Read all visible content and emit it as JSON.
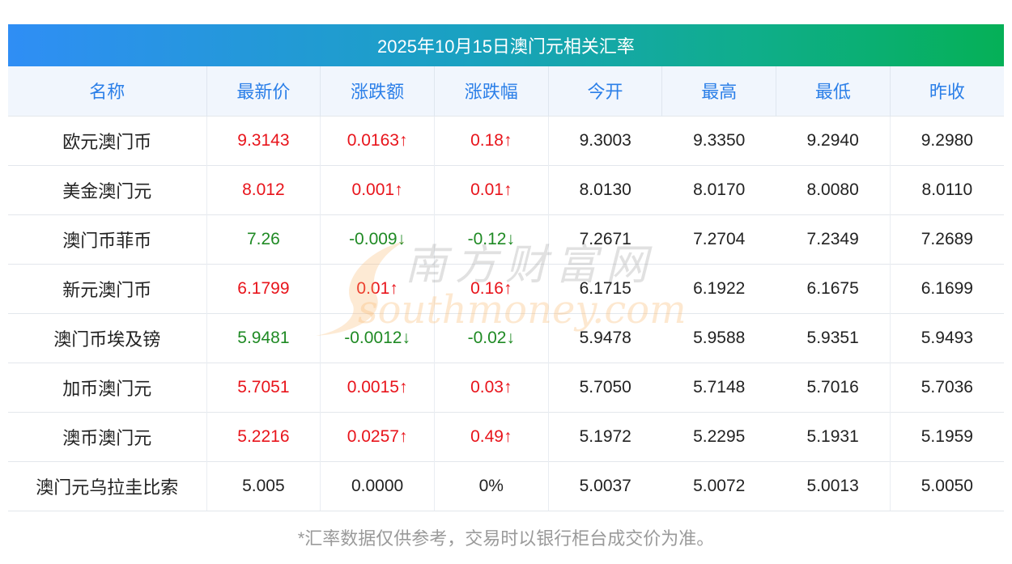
{
  "title": "2025年10月15日澳门元相关汇率",
  "columns": [
    "名称",
    "最新价",
    "涨跌额",
    "涨跌幅",
    "今开",
    "最高",
    "最低",
    "昨收"
  ],
  "rows": [
    {
      "name": "欧元澳门币",
      "latest": "9.3143",
      "change": "0.0163↑",
      "pct": "0.18↑",
      "open": "9.3003",
      "high": "9.3350",
      "low": "9.2940",
      "prev": "9.2980",
      "trend": "up"
    },
    {
      "name": "美金澳门元",
      "latest": "8.012",
      "change": "0.001↑",
      "pct": "0.01↑",
      "open": "8.0130",
      "high": "8.0170",
      "low": "8.0080",
      "prev": "8.0110",
      "trend": "up"
    },
    {
      "name": "澳门币菲币",
      "latest": "7.26",
      "change": "-0.009↓",
      "pct": "-0.12↓",
      "open": "7.2671",
      "high": "7.2704",
      "low": "7.2349",
      "prev": "7.2689",
      "trend": "down"
    },
    {
      "name": "新元澳门币",
      "latest": "6.1799",
      "change": "0.01↑",
      "pct": "0.16↑",
      "open": "6.1715",
      "high": "6.1922",
      "low": "6.1675",
      "prev": "6.1699",
      "trend": "up"
    },
    {
      "name": "澳门币埃及镑",
      "latest": "5.9481",
      "change": "-0.0012↓",
      "pct": "-0.02↓",
      "open": "5.9478",
      "high": "5.9588",
      "low": "5.9351",
      "prev": "5.9493",
      "trend": "down"
    },
    {
      "name": "加币澳门元",
      "latest": "5.7051",
      "change": "0.0015↑",
      "pct": "0.03↑",
      "open": "5.7050",
      "high": "5.7148",
      "low": "5.7016",
      "prev": "5.7036",
      "trend": "up"
    },
    {
      "name": "澳币澳门元",
      "latest": "5.2216",
      "change": "0.0257↑",
      "pct": "0.49↑",
      "open": "5.1972",
      "high": "5.2295",
      "low": "5.1931",
      "prev": "5.1959",
      "trend": "up"
    },
    {
      "name": "澳门元乌拉圭比索",
      "latest": "5.005",
      "change": "0.0000",
      "pct": "0%",
      "open": "5.0037",
      "high": "5.0072",
      "low": "5.0013",
      "prev": "5.0050",
      "trend": "flat"
    }
  ],
  "footnote": "*汇率数据仅供参考，交易时以银行柜台成交价为准。",
  "watermark": {
    "text": "南方财富网",
    "url": "southmoney.com"
  },
  "colors": {
    "up": "#e8141b",
    "down": "#1f8a24",
    "header_text": "#2b7fe8",
    "title_gradient_start": "#2f8ef5",
    "title_gradient_end": "#05b057"
  }
}
